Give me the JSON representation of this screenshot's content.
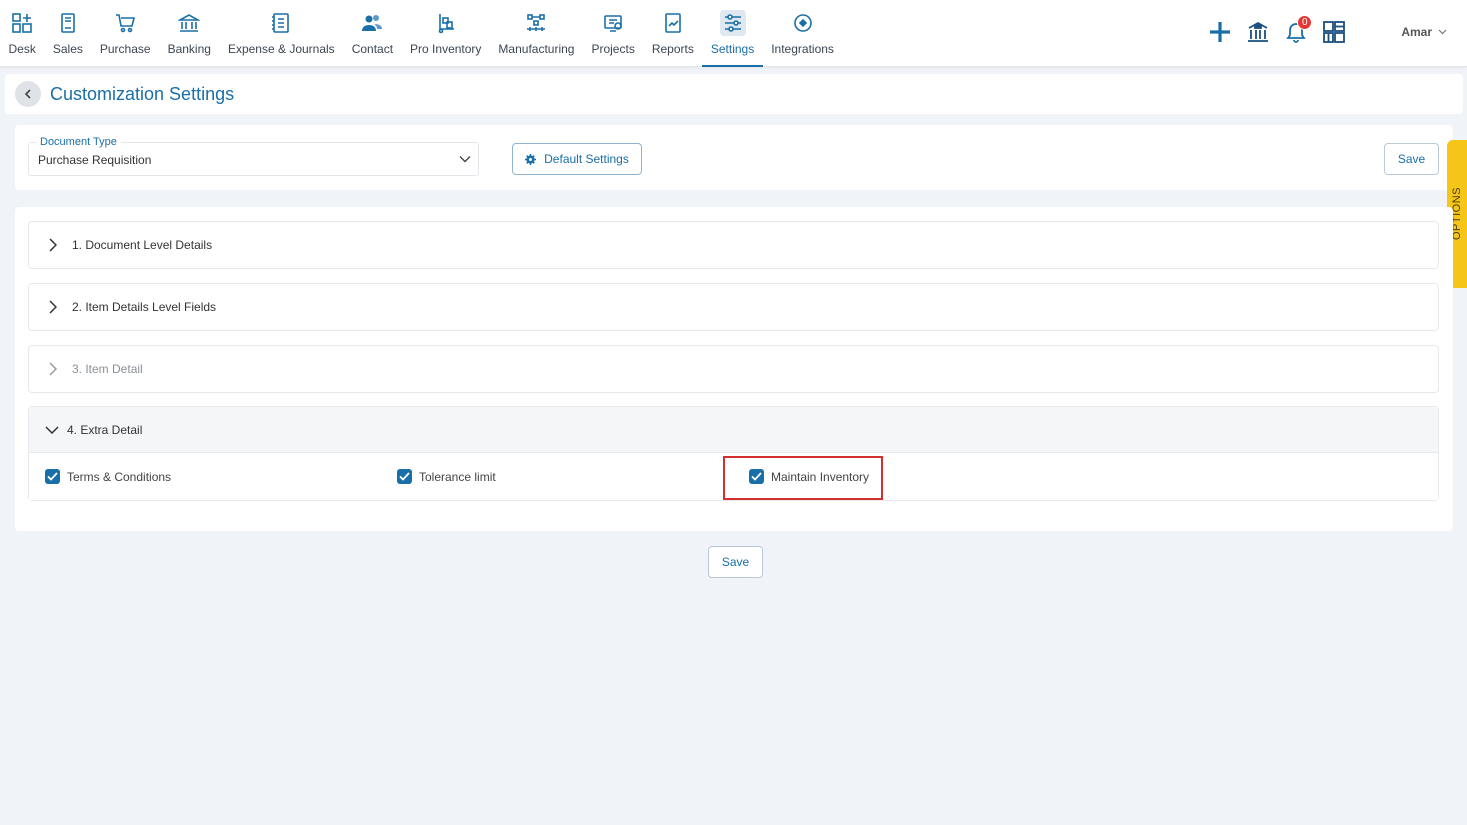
{
  "nav": {
    "items": [
      {
        "label": "Desk",
        "icon": "desk-icon"
      },
      {
        "label": "Sales",
        "icon": "sales-icon"
      },
      {
        "label": "Purchase",
        "icon": "cart-icon"
      },
      {
        "label": "Banking",
        "icon": "bank-icon"
      },
      {
        "label": "Expense & Journals",
        "icon": "journal-icon"
      },
      {
        "label": "Contact",
        "icon": "contacts-icon"
      },
      {
        "label": "Pro Inventory",
        "icon": "inventory-icon"
      },
      {
        "label": "Manufacturing",
        "icon": "manufacturing-icon"
      },
      {
        "label": "Projects",
        "icon": "projects-icon"
      },
      {
        "label": "Reports",
        "icon": "reports-icon"
      },
      {
        "label": "Settings",
        "icon": "settings-sliders-icon"
      },
      {
        "label": "Integrations",
        "icon": "integrations-icon"
      }
    ],
    "active": "Settings"
  },
  "tools": {
    "notification_count": "0",
    "user_name": "Amar"
  },
  "header": {
    "title": "Customization Settings"
  },
  "doc_type": {
    "label": "Document Type",
    "value": "Purchase Requisition",
    "default_settings_label": "Default Settings",
    "save_label": "Save"
  },
  "options_tab": "OPTIONS",
  "sections": [
    {
      "title": "1. Document Level Details",
      "expanded": false
    },
    {
      "title": "2. Item Details Level Fields",
      "expanded": false
    },
    {
      "title": "3. Item Detail",
      "expanded": false,
      "disabled": true
    },
    {
      "title": "4. Extra Detail",
      "expanded": true
    }
  ],
  "extra_detail": {
    "checkboxes": [
      {
        "label": "Terms & Conditions",
        "checked": true
      },
      {
        "label": "Tolerance limit",
        "checked": true
      },
      {
        "label": "Maintain Inventory",
        "checked": true
      }
    ]
  },
  "footer": {
    "save_label": "Save"
  },
  "colors": {
    "primary": "#1a6fa8",
    "highlight": "#d32f2f",
    "options_tab": "#f5c518",
    "badge": "#e53935"
  }
}
